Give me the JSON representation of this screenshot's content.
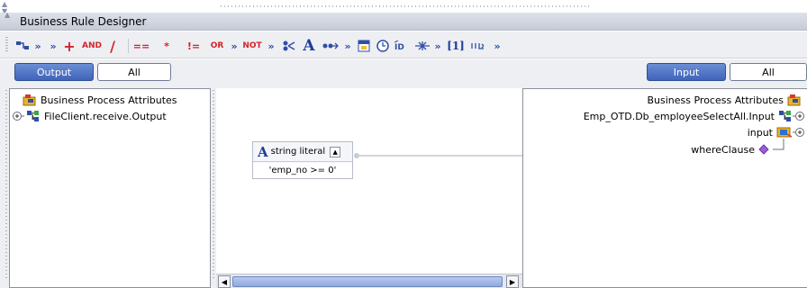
{
  "window": {
    "title": "Business Rule Designer"
  },
  "toolbar": {
    "items": [
      {
        "name": "toggle-mapper-icon",
        "text": ""
      },
      {
        "name": "more-arrows-1",
        "text": "»"
      },
      {
        "name": "more-arrows-2",
        "text": "»"
      },
      {
        "name": "add-icon",
        "text": "+"
      },
      {
        "name": "and-operator",
        "text": "AND"
      },
      {
        "name": "divide-icon",
        "text": "/"
      },
      {
        "name": "equals-operator",
        "text": "=="
      },
      {
        "name": "asterisk-operator",
        "text": "*"
      },
      {
        "name": "not-equals-operator",
        "text": "!="
      },
      {
        "name": "or-operator",
        "text": "OR"
      },
      {
        "name": "more-arrows-3",
        "text": "»"
      },
      {
        "name": "not-operator",
        "text": "NOT"
      },
      {
        "name": "more-arrows-4",
        "text": "»"
      },
      {
        "name": "substring-icon",
        "text": ""
      },
      {
        "name": "string-literal-icon",
        "text": "A"
      },
      {
        "name": "concat-icon",
        "text": ""
      },
      {
        "name": "more-arrows-5",
        "text": "»"
      },
      {
        "name": "date-icon",
        "text": ""
      },
      {
        "name": "clock-icon",
        "text": ""
      },
      {
        "name": "id-icon",
        "text": ""
      },
      {
        "name": "split-icon",
        "text": ""
      },
      {
        "name": "more-arrows-6",
        "text": "»"
      },
      {
        "name": "array-index-icon",
        "text": "[1]"
      },
      {
        "name": "boolean-icon",
        "text": ""
      },
      {
        "name": "more-arrows-7",
        "text": "»"
      }
    ]
  },
  "left_tabs": {
    "output": "Output",
    "all": "All"
  },
  "right_tabs": {
    "input": "Input",
    "all": "All"
  },
  "left_tree": {
    "root": "Business Process Attributes",
    "child": "FileClient.receive.Output"
  },
  "right_tree": {
    "root": "Business Process Attributes",
    "child": "Emp_OTD.Db_employeeSelectAll.Input",
    "grandchild": "input",
    "leaf": "whereClause"
  },
  "node": {
    "title": "string literal",
    "value": "'emp_no >= 0'"
  },
  "colors": {
    "accent": "#3f63b8",
    "connector": "#a8aab4",
    "toolbar_red": "#d4232b",
    "toolbar_blue": "#2e4fa8"
  }
}
